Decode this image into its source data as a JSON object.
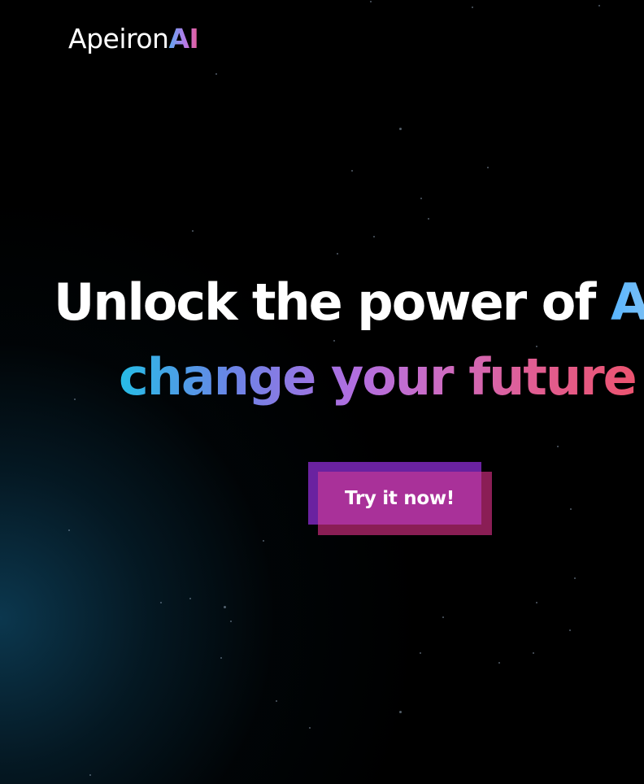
{
  "header": {
    "logo_main": "Apeiron",
    "logo_accent": "AI"
  },
  "hero": {
    "headline_line1": "Unlock the power of ",
    "headline_line1_accent": "AI",
    "headline_line2": "change your future"
  },
  "cta": {
    "label": "Try it now!"
  },
  "colors": {
    "background": "#000000",
    "glow": "#0c3a52",
    "button_fill": "#a93199",
    "button_back": "#6a22a0",
    "button_shadow": "#8a1e55",
    "gradient_start": "#26bde6",
    "gradient_mid": "#b06ee0",
    "gradient_end": "#ec5470"
  }
}
